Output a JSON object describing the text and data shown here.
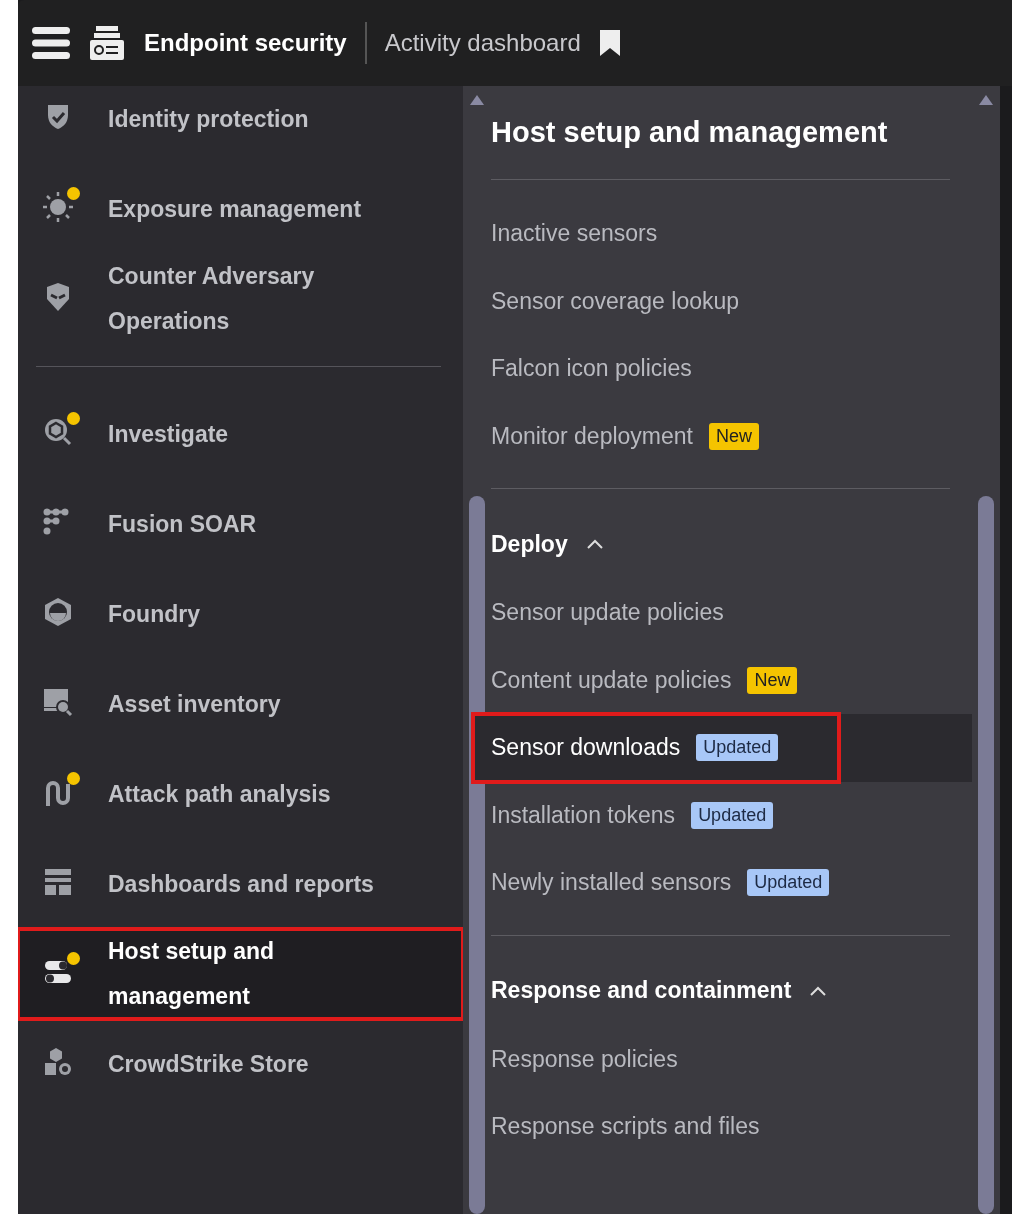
{
  "top_bar": {
    "app_title": "Endpoint security",
    "page_title": "Activity dashboard"
  },
  "sidebar": {
    "groups": [
      {
        "items": [
          {
            "label": "Identity protection",
            "notification": false,
            "selected": false,
            "highlighted": false
          },
          {
            "label": "Exposure management",
            "notification": true,
            "selected": false,
            "highlighted": false
          },
          {
            "label": "Counter Adversary Operations",
            "notification": false,
            "selected": false,
            "highlighted": false
          }
        ]
      },
      {
        "items": [
          {
            "label": "Investigate",
            "notification": true,
            "selected": false,
            "highlighted": false
          },
          {
            "label": "Fusion SOAR",
            "notification": false,
            "selected": false,
            "highlighted": false
          },
          {
            "label": "Foundry",
            "notification": false,
            "selected": false,
            "highlighted": false
          },
          {
            "label": "Asset inventory",
            "notification": false,
            "selected": false,
            "highlighted": false
          },
          {
            "label": "Attack path analysis",
            "notification": true,
            "selected": false,
            "highlighted": false
          },
          {
            "label": "Dashboards and reports",
            "notification": false,
            "selected": false,
            "highlighted": false
          },
          {
            "label": "Host setup and management",
            "notification": true,
            "selected": true,
            "highlighted": true
          },
          {
            "label": "CrowdStrike Store",
            "notification": false,
            "selected": false,
            "highlighted": false
          }
        ]
      }
    ]
  },
  "submenu": {
    "title": "Host setup and management",
    "sections": [
      {
        "items": [
          {
            "label": "Inactive sensors",
            "selected": false,
            "highlighted": false
          },
          {
            "label": "Sensor coverage lookup",
            "selected": false,
            "highlighted": false
          },
          {
            "label": "Falcon icon policies",
            "selected": false,
            "highlighted": false
          },
          {
            "label": "Monitor deployment",
            "badge": {
              "text": "New",
              "kind": "new"
            },
            "selected": false,
            "highlighted": false
          }
        ]
      },
      {
        "heading": "Deploy",
        "expanded": true,
        "items": [
          {
            "label": "Sensor update policies",
            "selected": false,
            "highlighted": false
          },
          {
            "label": "Content update policies",
            "badge": {
              "text": "New",
              "kind": "new"
            },
            "selected": false,
            "highlighted": false
          },
          {
            "label": "Sensor downloads",
            "badge": {
              "text": "Updated",
              "kind": "updated"
            },
            "selected": true,
            "highlighted": true
          },
          {
            "label": "Installation tokens",
            "badge": {
              "text": "Updated",
              "kind": "updated"
            },
            "selected": false,
            "highlighted": false
          },
          {
            "label": "Newly installed sensors",
            "badge": {
              "text": "Updated",
              "kind": "updated"
            },
            "selected": false,
            "highlighted": false
          }
        ]
      },
      {
        "heading": "Response and containment",
        "expanded": true,
        "items": [
          {
            "label": "Response policies",
            "selected": false,
            "highlighted": false
          },
          {
            "label": "Response scripts and files",
            "selected": false,
            "highlighted": false
          }
        ]
      }
    ]
  }
}
